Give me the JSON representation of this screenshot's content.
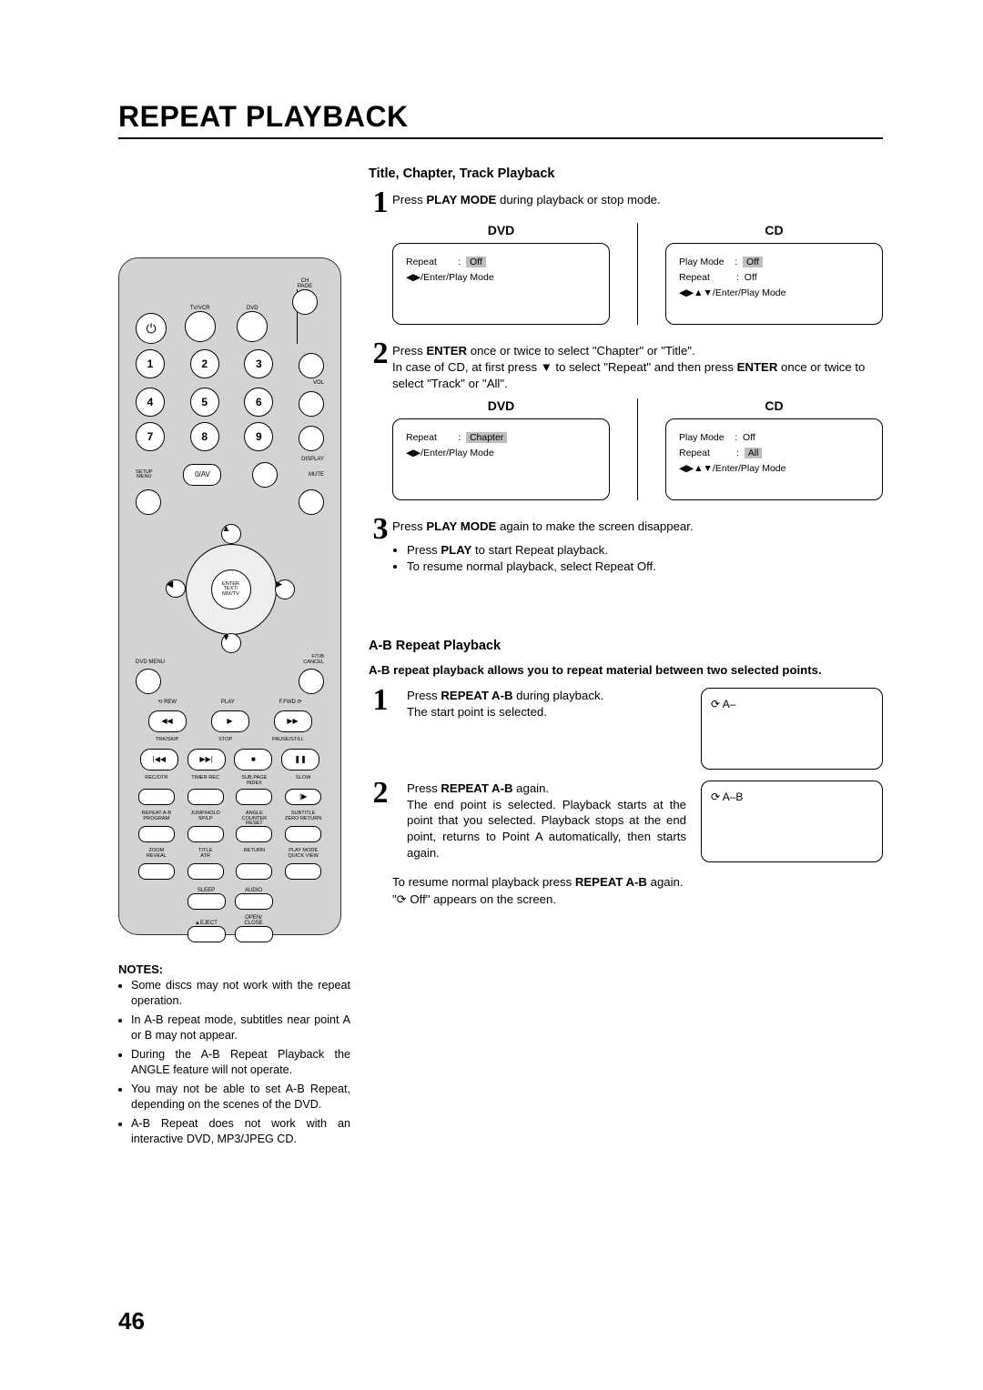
{
  "page": {
    "title": "REPEAT PLAYBACK",
    "number": "46"
  },
  "section1": {
    "heading": "Title, Chapter, Track Playback",
    "step1": {
      "n": "1",
      "text_pre": "Press ",
      "text_bold": "PLAY MODE",
      "text_post": " during playback or stop mode."
    },
    "dvd_label": "DVD",
    "cd_label": "CD",
    "screen1_dvd": {
      "l1a": "Repeat",
      "l1b": "Off",
      "l2": "◀▶/Enter/Play Mode"
    },
    "screen1_cd": {
      "l1a": "Play Mode",
      "l1b": "Off",
      "l2a": "Repeat",
      "l2b": "Off",
      "l3": "◀▶▲▼/Enter/Play Mode"
    },
    "step2": {
      "n": "2",
      "line1_pre": "Press ",
      "line1_b": "ENTER",
      "line1_post": " once or twice to select \"Chapter\" or \"Title\".",
      "line2_pre": "In case of CD, at first press ▼ to select \"Repeat\" and then press ",
      "line2_b": "ENTER",
      "line2_post": " once or twice to select \"Track\" or \"All\"."
    },
    "screen2_dvd": {
      "l1a": "Repeat",
      "l1b": "Chapter",
      "l2": "◀▶/Enter/Play Mode"
    },
    "screen2_cd": {
      "l1a": "Play Mode",
      "l1b": "Off",
      "l2a": "Repeat",
      "l2b": "All",
      "l3": "◀▶▲▼/Enter/Play Mode"
    },
    "step3": {
      "n": "3",
      "line1_pre": "Press ",
      "line1_b": "PLAY MODE",
      "line1_post": " again to make the screen disappear.",
      "b1_pre": "Press ",
      "b1_b": "PLAY",
      "b1_post": " to start Repeat playback.",
      "b2": "To resume normal playback, select Repeat Off."
    }
  },
  "section2": {
    "heading": "A-B Repeat Playback",
    "intro": "A-B repeat playback allows you to repeat material between two selected points.",
    "step1": {
      "n": "1",
      "l1_pre": "Press ",
      "l1_b": "REPEAT A-B",
      "l1_post": " during playback.",
      "l2": "The start point is selected.",
      "indicator": "⟳ A–"
    },
    "step2": {
      "n": "2",
      "l1_pre": "Press ",
      "l1_b": "REPEAT A-B",
      "l1_post": " again.",
      "l2": "The end point is selected. Playback starts at the point that you selected. Playback stops at the end point, returns to Point A automatically, then starts again.",
      "indicator": "⟳ A–B"
    },
    "resume_pre": "To resume normal playback press ",
    "resume_b": "REPEAT A-B",
    "resume_post": " again.",
    "resume_line2": "\"⟳ Off\" appears on the screen."
  },
  "notes": {
    "heading": "NOTES:",
    "items": [
      "Some discs may not work with the repeat operation.",
      "In A-B repeat mode, subtitles near point A or B may not appear.",
      "During the A-B Repeat Playback the ANGLE feature will not operate.",
      "You may not be able to set A-B Repeat, depending on the scenes of the DVD.",
      "A-B Repeat does not work with an interactive DVD, MP3/JPEG CD."
    ]
  },
  "remote": {
    "row1": [
      "",
      "TV/VCR",
      "DVD",
      "CH\nPAGE"
    ],
    "power": "⏻",
    "nums": [
      "1",
      "2",
      "3",
      "4",
      "5",
      "6",
      "7",
      "8",
      "9"
    ],
    "display": "DISPLAY",
    "zero_av": "0/AV",
    "setup": "SETUP\nMENU",
    "mute": "MUTE",
    "enter": "ENTER\nTEXT/\nMIX/TV",
    "dvdmenu": "DVD MENU",
    "ftb": "F/T/B\nCANCEL",
    "rew": "⟲ REW",
    "play": "PLAY",
    "ffwd": "F.FWD ⟳",
    "trk": "TRK/SKIP",
    "stop": "STOP",
    "pause": "PAUSE/STILL",
    "rec": "REC/OTR",
    "timer": "TIMER REC",
    "sub": "SUB.PAGE\nINDEX",
    "slow": "SLOW",
    "r1": [
      "REPEAT A-B\nPROGRAM",
      "JUMP/HOLD\nSP/LP",
      "ANGLE\nCOUNTER RESET",
      "SUBTITLE\nZERO RETURN"
    ],
    "r2": [
      "ZOOM\nREVEAL",
      "TITLE\nATR",
      "RETURN",
      "PLAY MODE\nQUICK VIEW"
    ],
    "sleep": "SLEEP",
    "audio": "AUDIO",
    "eject": "▲EJECT",
    "open": "OPEN/\nCLOSE",
    "vol": "VOL"
  }
}
